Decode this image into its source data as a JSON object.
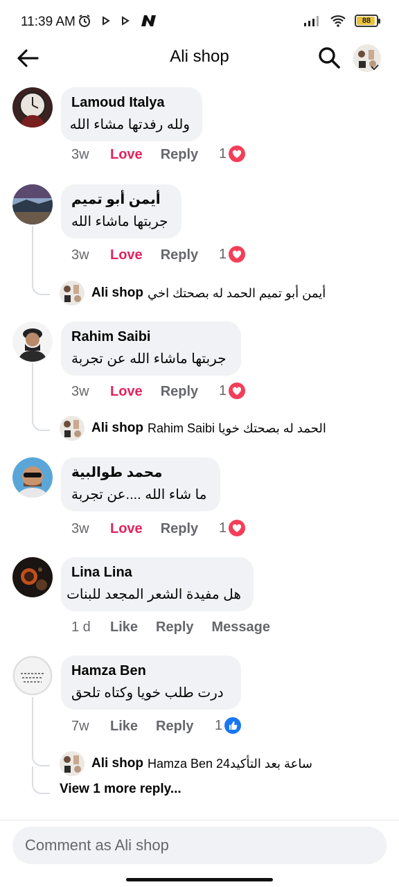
{
  "status_bar": {
    "time": "11:39 AM",
    "battery": "88"
  },
  "header": {
    "title": "Ali shop"
  },
  "comments": [
    {
      "name": "Lamoud Italya",
      "text": "ولله رفدتها مشاء الله",
      "time": "3w",
      "action1": "Love",
      "action2": "Reply",
      "reaction_count": "1",
      "reaction_type": "heart"
    },
    {
      "name": "أيمن أبو تميم",
      "text": "جربتها ماشاء الله",
      "time": "3w",
      "action1": "Love",
      "action2": "Reply",
      "reaction_count": "1",
      "reaction_type": "heart",
      "reply": {
        "name": "Ali shop",
        "text": "أيمن أبو تميم الحمد له بصحتك اخي"
      }
    },
    {
      "name": "Rahim Saibi",
      "text": "جربتها ماشاء الله عن تجربة",
      "time": "3w",
      "action1": "Love",
      "action2": "Reply",
      "reaction_count": "1",
      "reaction_type": "heart",
      "reply": {
        "name": "Ali shop",
        "text": "Rahim Saibi الحمد له بصحتك خويا"
      }
    },
    {
      "name": "محمد طوالبية",
      "text": "ما شاء الله ....عن تجربة",
      "time": "3w",
      "action1": "Love",
      "action2": "Reply",
      "reaction_count": "1",
      "reaction_type": "heart"
    },
    {
      "name": "Lina Lina",
      "text": "هل مفيدة الشعر المجعد للبنات",
      "time": "1 d",
      "action1": "Like",
      "action2": "Reply",
      "action3": "Message"
    },
    {
      "name": "Hamza Ben",
      "text": "درت طلب خويا وكتاه تلحق",
      "time": "7w",
      "action1": "Like",
      "action2": "Reply",
      "reaction_count": "1",
      "reaction_type": "like",
      "reply": {
        "name": "Ali shop",
        "text": "Hamza Ben 24ساعة بعد التأكيد"
      },
      "view_more": "View 1 more reply..."
    }
  ],
  "composer": {
    "placeholder": "Comment as Ali shop"
  },
  "colors": {
    "love": "#e0245e",
    "heart_badge": "#f33e58",
    "like_badge": "#1877f2",
    "bubble": "#f0f2f5"
  }
}
